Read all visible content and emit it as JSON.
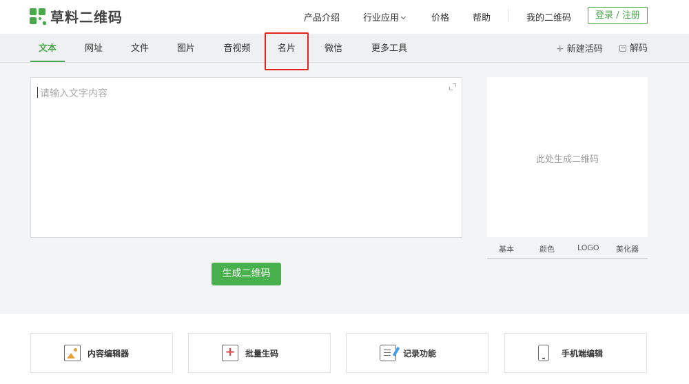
{
  "header": {
    "logo_text": "草料二维码",
    "nav": [
      {
        "label": "产品介绍"
      },
      {
        "label": "行业应用"
      },
      {
        "label": "价格"
      },
      {
        "label": "帮助"
      },
      {
        "label": "我的二维码"
      }
    ],
    "login_label": "登录 / 注册"
  },
  "tabs": [
    {
      "label": "文本"
    },
    {
      "label": "网址"
    },
    {
      "label": "文件"
    },
    {
      "label": "图片"
    },
    {
      "label": "音视频"
    },
    {
      "label": "名片"
    },
    {
      "label": "微信"
    },
    {
      "label": "更多工具"
    }
  ],
  "tools": {
    "new_code_label": "新建活码",
    "decode_label": "解码"
  },
  "editor": {
    "placeholder": "请输入文字内容"
  },
  "generate_label": "生成二维码",
  "qr_panel": {
    "placeholder": "此处生成二维码",
    "tabs": [
      {
        "label": "基本"
      },
      {
        "label": "颜色"
      },
      {
        "label": "LOGO"
      },
      {
        "label": "美化器"
      }
    ]
  },
  "features": [
    {
      "label": "内容编辑器",
      "icon": "content-editor-icon"
    },
    {
      "label": "批量生码",
      "icon": "batch-generate-icon"
    },
    {
      "label": "记录功能",
      "icon": "record-icon"
    },
    {
      "label": "手机端编辑",
      "icon": "mobile-edit-icon"
    }
  ],
  "colors": {
    "accent": "#48a84a",
    "highlight": "#e5221b"
  }
}
